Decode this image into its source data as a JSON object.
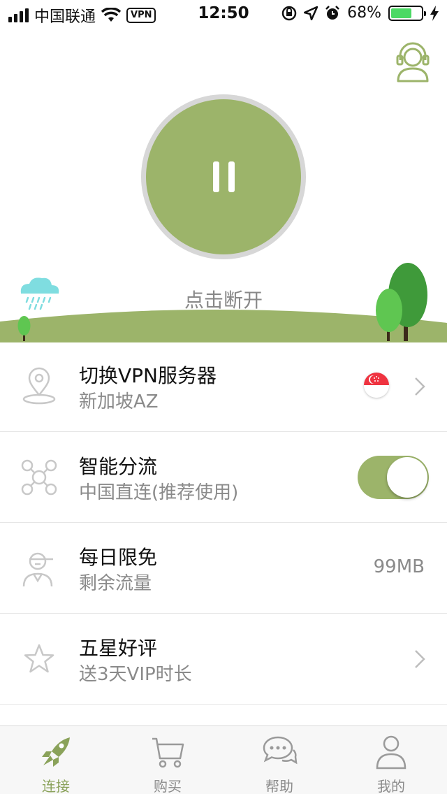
{
  "status_bar": {
    "carrier": "中国联通",
    "vpn_badge": "VPN",
    "time": "12:50",
    "battery_percent": "68%",
    "battery_level": 0.68
  },
  "connect": {
    "status_text": "点击断开",
    "state": "connected"
  },
  "list": {
    "server": {
      "title": "切换VPN服务器",
      "subtitle": "新加坡AZ",
      "flag_icon": "singapore-flag-icon"
    },
    "smart": {
      "title": "智能分流",
      "subtitle": "中国直连(推荐使用)",
      "toggle_on": true
    },
    "free": {
      "title": "每日限免",
      "subtitle": "剩余流量",
      "value": "99MB"
    },
    "rate": {
      "title": "五星好评",
      "subtitle": "送3天VIP时长"
    }
  },
  "tabs": [
    {
      "label": "连接",
      "icon": "rocket-icon",
      "active": true
    },
    {
      "label": "购买",
      "icon": "cart-icon",
      "active": false
    },
    {
      "label": "帮助",
      "icon": "chat-icon",
      "active": false
    },
    {
      "label": "我的",
      "icon": "user-icon",
      "active": false
    }
  ],
  "colors": {
    "accent": "#9cb46a",
    "accent_dark": "#8aa25a",
    "grass": "#9cb46a",
    "tree_dark": "#3f9a3a",
    "tree_light": "#5fc651"
  }
}
